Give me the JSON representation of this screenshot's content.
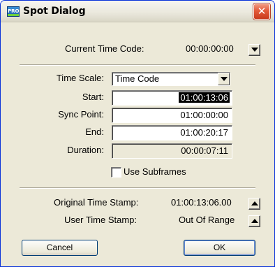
{
  "window": {
    "title": "Spot Dialog",
    "app_icon_text": "PRO",
    "close_glyph": "✕"
  },
  "current_time_code": {
    "label": "Current Time Code:",
    "value": "00:00:00:00"
  },
  "time_scale": {
    "label": "Time Scale:",
    "selected": "Time Code"
  },
  "fields": {
    "start": {
      "label": "Start:",
      "value": "01:00:13:06"
    },
    "sync_point": {
      "label": "Sync Point:",
      "value": "01:00:00:00"
    },
    "end": {
      "label": "End:",
      "value": "01:00:20:17"
    },
    "duration": {
      "label": "Duration:",
      "value": "00:00:07:11"
    }
  },
  "use_subframes": {
    "label": "Use Subframes",
    "checked": false
  },
  "original_time_stamp": {
    "label": "Original Time Stamp:",
    "value": "01:00:13:06.00"
  },
  "user_time_stamp": {
    "label": "User Time Stamp:",
    "value": "Out Of Range"
  },
  "buttons": {
    "cancel": "Cancel",
    "ok": "OK"
  }
}
